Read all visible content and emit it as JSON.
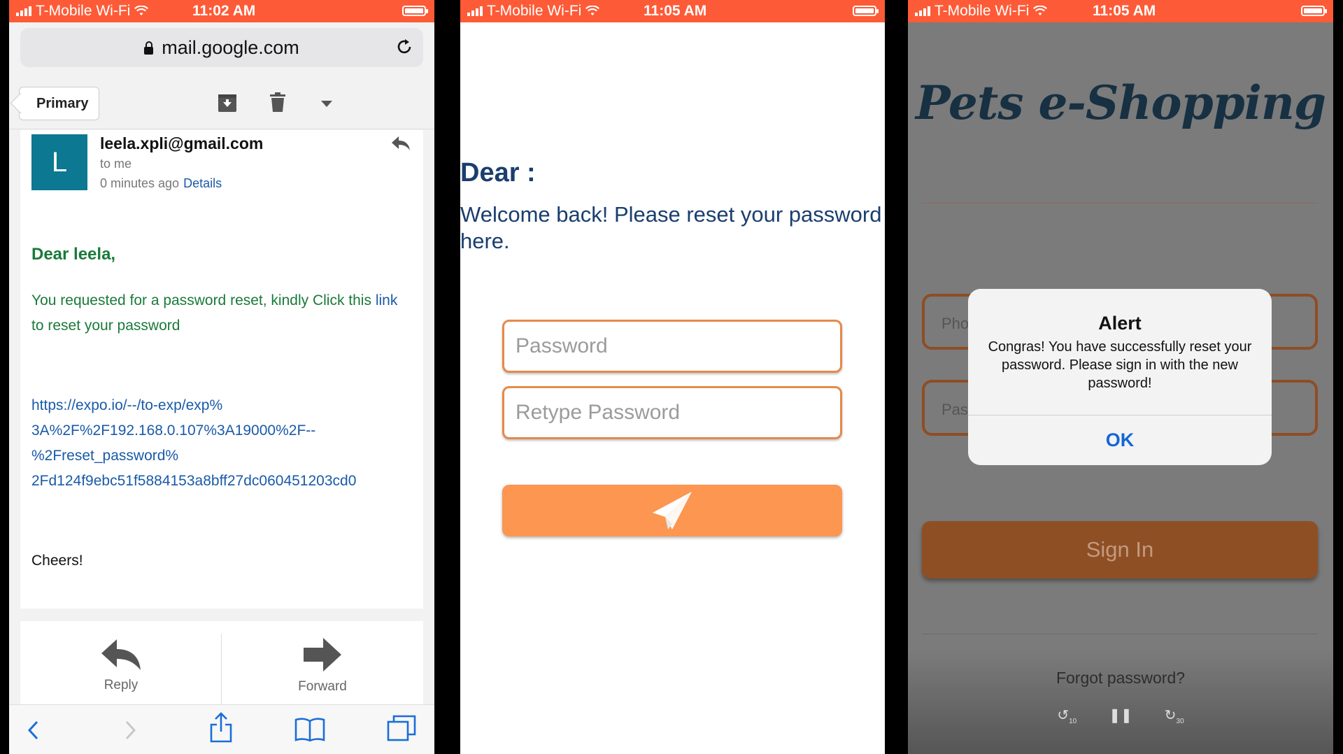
{
  "screen1": {
    "status": {
      "carrier": "T-Mobile Wi-Fi",
      "time": "11:02 AM",
      "battery": 0.85
    },
    "url": "mail.google.com",
    "primary_tab": "Primary",
    "sender": "leela.xpli@gmail.com",
    "avatar_letter": "L",
    "to": "to me",
    "when": "0 minutes ago",
    "details": "Details",
    "greeting": "Dear leela,",
    "body_part1": "You requested for a password reset, kindly Click this",
    "body_link": "link",
    "body_part2": " to reset your password",
    "link_url": "https://expo.io/--/to-exp/exp%3A%2F%2F192.168.0.107%3A19000%2F--%2Freset_password%2Fd124f9ebc51f5884153a8bff27dc060451203cd0",
    "link_lines": [
      "https://expo.io/--/to-exp/exp%",
      "3A%2F%2F192.168.0.107%3A19000%2F--",
      "%2Freset_password%",
      "2Fd124f9ebc51f5884153a8bff27dc060451203cd0"
    ],
    "signoff": "Cheers!",
    "reply_label": "Reply",
    "forward_label": "Forward"
  },
  "screen2": {
    "status": {
      "carrier": "T-Mobile Wi-Fi",
      "time": "11:05 AM",
      "battery": 0.85
    },
    "dear": "Dear :",
    "welcome": "Welcome back! Please reset your password here.",
    "password_placeholder": "Password",
    "retype_placeholder": "Retype Password"
  },
  "screen3": {
    "status": {
      "carrier": "T-Mobile Wi-Fi",
      "time": "11:05 AM",
      "battery": 0.85
    },
    "logo": "Pets e-Shopping",
    "phone_placeholder_partial": "Pho",
    "password_placeholder_partial": "Pas",
    "signin_label": "Sign In",
    "forgot": "Forgot password?",
    "video_controls": {
      "back": "10",
      "forward": "30"
    },
    "alert": {
      "title": "Alert",
      "message": "Congras! You have successfully reset your password. Please sign in with the new password!",
      "ok": "OK"
    }
  },
  "colors": {
    "status_bar": "#fd5b37",
    "gmail_avatar": "#0d7891",
    "email_green": "#1a7a3a",
    "link_blue": "#1a5aa8",
    "dear_navy": "#1a3e6e",
    "field_border": "#e58a4a",
    "send_button": "#fc9651",
    "signin_button": "#8f4f24",
    "alert_ok": "#1466d6"
  }
}
